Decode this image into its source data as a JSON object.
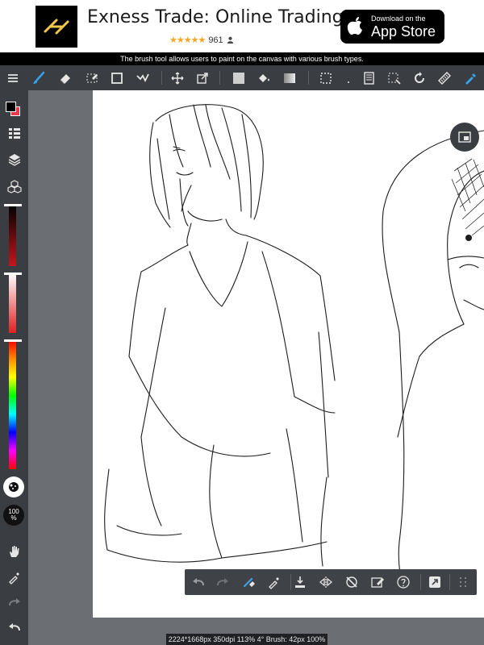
{
  "ad": {
    "title": "Exness Trade: Online Trading",
    "stars": "★★★★★",
    "rating_count": "961",
    "store_small": "Download on the",
    "store_big": "App Store"
  },
  "info_text": "The brush tool allows users to paint on the canvas with various brush types.",
  "toolbar": {
    "icons": [
      "menu-icon",
      "brush-icon",
      "eraser-icon",
      "lasso-eraser-icon",
      "rectangle-icon",
      "select-pen-icon",
      "move-icon",
      "transform-icon",
      "fill-color-icon",
      "bucket-icon",
      "gradient-icon",
      "selection-icon",
      "dot-icon",
      "layer-panel-icon",
      "select-area-icon",
      "rotate-icon",
      "ruler-icon",
      "eyedropper-icon"
    ],
    "accent": "#3aa0e8"
  },
  "sidebar": {
    "foreground_color": "#000000",
    "background_color": "#e53a4a",
    "opacity_label_top": "100",
    "opacity_label_bottom": "%"
  },
  "bottom_bar": {
    "icons": [
      "undo-icon",
      "redo-icon",
      "brush-eraser-icon",
      "eyedropper-icon",
      "import-icon",
      "flip-icon",
      "snap-off-icon",
      "edit-icon",
      "help-icon",
      "export-icon",
      "grid-icon"
    ]
  },
  "status": "2224*1668px 350dpi 113% 4° Brush: 42px 100%"
}
